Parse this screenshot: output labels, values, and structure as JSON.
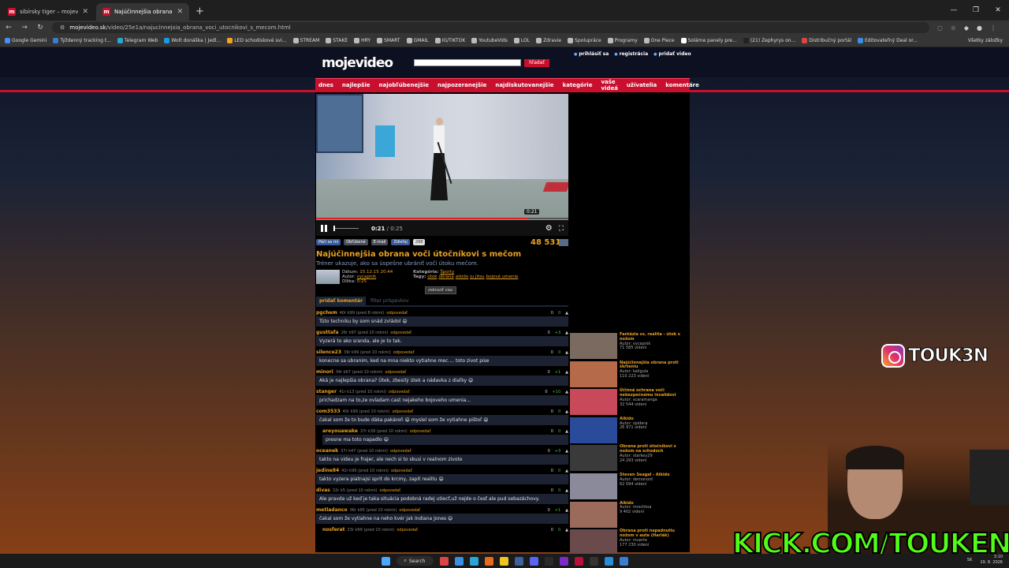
{
  "browser": {
    "tabs": [
      {
        "title": "sibírsky tiger – mojevideo.sk",
        "active": false
      },
      {
        "title": "Najúčinnejšia obrana voči...",
        "active": true
      }
    ],
    "url_domain": "mojevideo.sk",
    "url_path": "/video/25e1a/najucinnejsia_obrana_voci_utocnikovi_s_mecom.html",
    "bookmarks": [
      "Google Gemini",
      "Týždenný tracking t...",
      "Telegram Web",
      "Wolt donáška | Jedl...",
      "LED schodiskové svi...",
      "STREAM",
      "STAKE",
      "HRY",
      "SMART",
      "GMAIL",
      "IG/TIKTOK",
      "YoutubeVids",
      "LOL",
      "Zdravie",
      "Spolupráce",
      "Programy",
      "One Piece",
      "Solárne panely pre...",
      "(21) Zephyrys on...",
      "Distribučný portál",
      "Editovateľný Deal or..."
    ],
    "all_bookmarks": "Všetky záložky"
  },
  "site": {
    "logo": "mojevideo",
    "search_button": "hľadať",
    "user_links": [
      "prihlásiť sa",
      "registrácia",
      "pridať video"
    ],
    "nav": [
      "dnes",
      "najlepšie",
      "najobľúbenejšie",
      "najpozeranejšie",
      "najdiskutovanejšie",
      "kategórie",
      "vaše videá",
      "užívatelia",
      "komentáre"
    ]
  },
  "video": {
    "hover_time": "0:21",
    "current": "0:21",
    "duration": " / 0:25",
    "progress": 0.84,
    "actions": [
      "Páči sa mi",
      "Obľúbené",
      "E-mail",
      "Zdieľaj",
      "298"
    ],
    "views": "48 531",
    "title": "Najúčinnejšia obrana voči útočníkovi s mečom",
    "description": "Tréner ukazuje, ako sa úspešne ubrániť voči útoku mečom.",
    "meta": {
      "date_label": "Dátum:",
      "date": "15.12.15 20:44",
      "author_label": "Autor:",
      "author": "vycapnik",
      "length_label": "Dĺžka:",
      "length": "0:25",
      "category_label": "Kategória:",
      "category": "Športy",
      "tags_label": "Tagy:",
      "tags": [
        "útok",
        "obrana",
        "aikido",
        "ju jitsu",
        "bojové umenie"
      ]
    },
    "show_more": "zobraziť viac"
  },
  "comments_tabs": [
    "pridať komentár",
    "filter príspevkov"
  ],
  "comments": [
    {
      "user": "pgchem",
      "meta": "40r k99 (pred 8 rokmi)",
      "reply": "odpovedať",
      "down": "0",
      "up": "0",
      "text": "Túto techniku by som snád zvládol 😄",
      "nested": false
    },
    {
      "user": "gusttafa",
      "meta": "26r k97 (pred 10 rokmi)",
      "reply": "odpovedať",
      "down": "0",
      "up": "+3",
      "text": "Vyzerá to ako sranda, ale je to tak.",
      "nested": false
    },
    {
      "user": "silence23",
      "meta": "39r k99 (pred 10 rokmi)",
      "reply": "odpovedať",
      "down": "0",
      "up": "0",
      "text": "konecne sa ubranim, ked na mna niekto vytiahne mec.... toto zivot pise",
      "nested": false
    },
    {
      "user": "minori",
      "meta": "34r k67 (pred 10 rokmi)",
      "reply": "odpovedať",
      "down": "0",
      "up": "+1",
      "text": "Aká je najlepšia obrana? Útek, zbesilý útek a nádavka z diaľky 😄",
      "nested": false
    },
    {
      "user": "stanger",
      "meta": "41r k13 (pred 10 rokmi)",
      "reply": "odpovedať",
      "down": "0",
      "up": "+10",
      "text": "prichadzam na to,ze ovladam cast nejakeho bojoveho umenia...",
      "nested": false
    },
    {
      "user": "com3533",
      "meta": "40r k99 (pred 10 rokmi)",
      "reply": "odpovedať",
      "down": "0",
      "up": "0",
      "text": "čakal som že to bude dáka pakáreň 😄 myslel som že vytiahne pištoľ 😄",
      "nested": false
    },
    {
      "user": "areyouawake",
      "meta": "37r k39 (pred 10 rokmi)",
      "reply": "odpovedať",
      "down": "0",
      "up": "0",
      "text": "presne ma toto napadlo 😄",
      "nested": true
    },
    {
      "user": "oceanek",
      "meta": "37r k47 (pred 10 rokmi)",
      "reply": "odpovedať",
      "down": "0",
      "up": "+3",
      "text": "takto na videu je frajer, ale nech si to skusi v realnom zivote",
      "nested": false
    },
    {
      "user": "jedine84",
      "meta": "42r k99 (pred 10 rokmi)",
      "reply": "odpovedať",
      "down": "0",
      "up": "0",
      "text": "takto vyzera piatnajsi sprit do krcmy, zapit realitu 😄",
      "nested": false
    },
    {
      "user": "divas",
      "meta": "32r k5 (pred 10 rokmi)",
      "reply": "odpovedať",
      "down": "0",
      "up": "0",
      "text": "Ale pravda už keď je taka situácia podobná radej utiecť,už nejde o česť ale pud sebazáchovy.",
      "nested": false
    },
    {
      "user": "metladanco",
      "meta": "36r k95 (pred 10 rokmi)",
      "reply": "odpovedať",
      "down": "0",
      "up": "+1",
      "text": "čakal som že vytiahne na neho kvér jak Indiana Jones 😄",
      "nested": false
    },
    {
      "user": "nosferat",
      "meta": "33r k99 (pred 10 rokmi)",
      "reply": "odpovedať",
      "down": "0",
      "up": "0",
      "text": "",
      "nested": true
    }
  ],
  "related": [
    {
      "title": "Fantázia vs. realita - útok s nožom",
      "author": "Autor: vycapnik",
      "views": "71 585 videní",
      "color": "#7a6a60"
    },
    {
      "title": "Najúčinnejšia obrana proti škrteniu",
      "author": "Autor: kaligula",
      "views": "110 223 videní",
      "color": "#b56a4a"
    },
    {
      "title": "Účinná ochrana voči nebezpečnému invalidovi",
      "author": "Autor: scaramanga",
      "views": "32 544 videní",
      "color": "#c84a5a"
    },
    {
      "title": "Aikido",
      "author": "Autor: spidera",
      "views": "26 971 videní",
      "color": "#2a4a9a"
    },
    {
      "title": "Obrana proti útočníkovi s nožom na schodoch",
      "author": "Autor: starkey29",
      "views": "24 293 videní",
      "color": "#3a3a3a"
    },
    {
      "title": "Steven Seagal - Aikido",
      "author": "Autor: demonoid",
      "views": "62 094 videní",
      "color": "#8a8a9a"
    },
    {
      "title": "Aikido",
      "author": "Autor: mrschtoa",
      "views": "9 402 videní",
      "color": "#9a6a5a"
    },
    {
      "title": "Obrana proti napadnutiu nožom v aute (Harlák)",
      "author": "Autor: muerte",
      "views": "177 230 videní",
      "color": "#6a4a4a"
    }
  ],
  "overlays": {
    "instagram": "TOUK3N",
    "kick": "KICK.COM/TOUKEN"
  },
  "taskbar": {
    "search": "Search",
    "lang": "SK",
    "time": "3:10",
    "date": "19. 8. 2026"
  }
}
